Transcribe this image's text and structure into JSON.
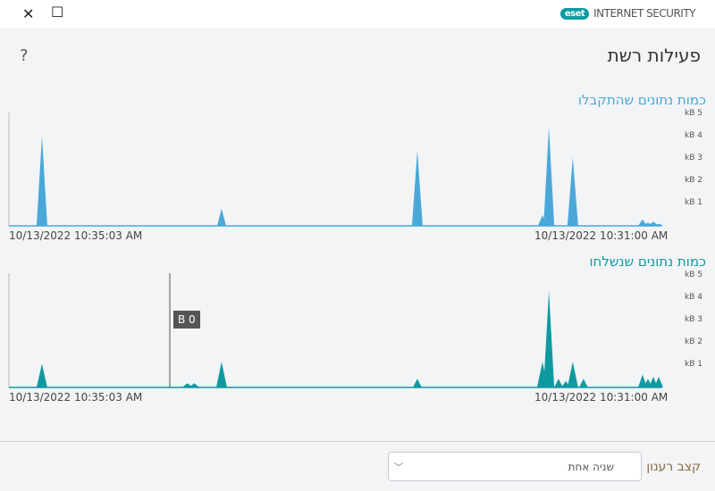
{
  "window": {
    "close_icon": "close-icon",
    "maximize_icon": "maximize-icon"
  },
  "brand": {
    "logo": "eset",
    "product": "INTERNET SECURITY"
  },
  "page": {
    "title": "פעילות רשת",
    "help": "?"
  },
  "colors": {
    "received": "#4aa8d8",
    "sent": "#0e9aa0",
    "received_title": "#4aa8d8",
    "sent_title": "#0e9aa0"
  },
  "chart_data": [
    {
      "type": "area",
      "title": "כמות נתונים שהתקבלו",
      "unit": "kB",
      "xlabel_left": "10/13/2022 10:35:03 AM",
      "xlabel_right": "10/13/2022 10:31:00 AM",
      "x_unit": "seconds after 10:31:00 (axis reversed)",
      "xlim": [
        243,
        0
      ],
      "ylim": [
        0,
        5
      ],
      "yticks": [
        "kB 5",
        "kB 4",
        "kB 3",
        "kB 2",
        "kB 1"
      ],
      "points": [
        [
          230.7,
          4.2
        ],
        [
          163.8,
          0.8
        ],
        [
          90.9,
          3.5
        ],
        [
          44.3,
          0.5
        ],
        [
          41.9,
          4.6
        ],
        [
          33,
          3.2
        ],
        [
          7,
          0.3
        ],
        [
          5,
          0.15
        ],
        [
          3,
          0.2
        ],
        [
          1,
          0.1
        ]
      ]
    },
    {
      "type": "area",
      "title": "כמות נתונים שנשלחו",
      "unit": "kB",
      "xlabel_left": "10/13/2022 10:35:03 AM",
      "xlabel_right": "10/13/2022 10:31:00 AM",
      "x_unit": "seconds after 10:31:00 (axis reversed)",
      "xlim": [
        243,
        0
      ],
      "ylim": [
        0,
        5
      ],
      "yticks": [
        "kB 5",
        "kB 4",
        "kB 3",
        "kB 2",
        "kB 1"
      ],
      "points": [
        [
          230.7,
          1.1
        ],
        [
          176.5,
          0.2
        ],
        [
          174,
          0.2
        ],
        [
          163.8,
          1.2
        ],
        [
          90.9,
          0.4
        ],
        [
          44.3,
          1.2
        ],
        [
          41.9,
          4.5
        ],
        [
          38.3,
          0.4
        ],
        [
          35.6,
          0.3
        ],
        [
          33,
          1.2
        ],
        [
          29,
          0.4
        ],
        [
          7,
          0.6
        ],
        [
          5,
          0.4
        ],
        [
          3,
          0.5
        ],
        [
          1,
          0.5
        ]
      ],
      "tooltip": "B 0"
    }
  ],
  "footer": {
    "label": "קצב רענון",
    "select_value": "שניה אחת"
  }
}
